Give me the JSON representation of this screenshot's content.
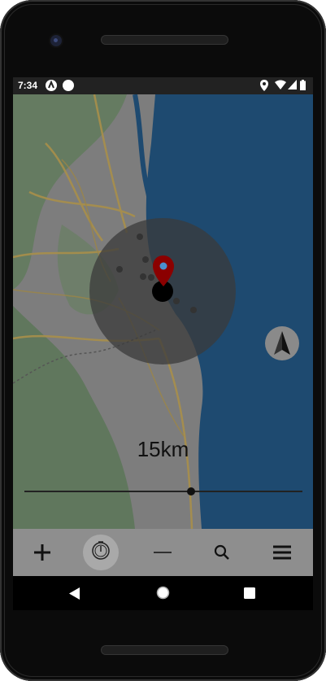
{
  "status_bar": {
    "time": "7:34",
    "icons": [
      "notification-a-icon",
      "circle-icon",
      "location-icon",
      "wifi-icon",
      "signal-icon",
      "battery-icon"
    ]
  },
  "map": {
    "water_color": "#1e4a70",
    "land_color": "#7f7f7f",
    "radius_circle_color": "#3b3b3b",
    "marker_color": "#8b0000"
  },
  "distance_label": "15km",
  "radius_slider": {
    "value_fraction": 0.6
  },
  "bottom_bar": {
    "buttons": [
      {
        "name": "add-button",
        "icon": "plus-icon"
      },
      {
        "name": "timer-button",
        "icon": "stopwatch-icon"
      },
      {
        "name": "minus-button",
        "icon": "minus-icon"
      },
      {
        "name": "search-button",
        "icon": "search-icon"
      },
      {
        "name": "menu-button",
        "icon": "hamburger-icon"
      }
    ]
  },
  "nav_bar": {
    "icons": [
      "back-icon",
      "home-icon",
      "recents-icon"
    ]
  }
}
